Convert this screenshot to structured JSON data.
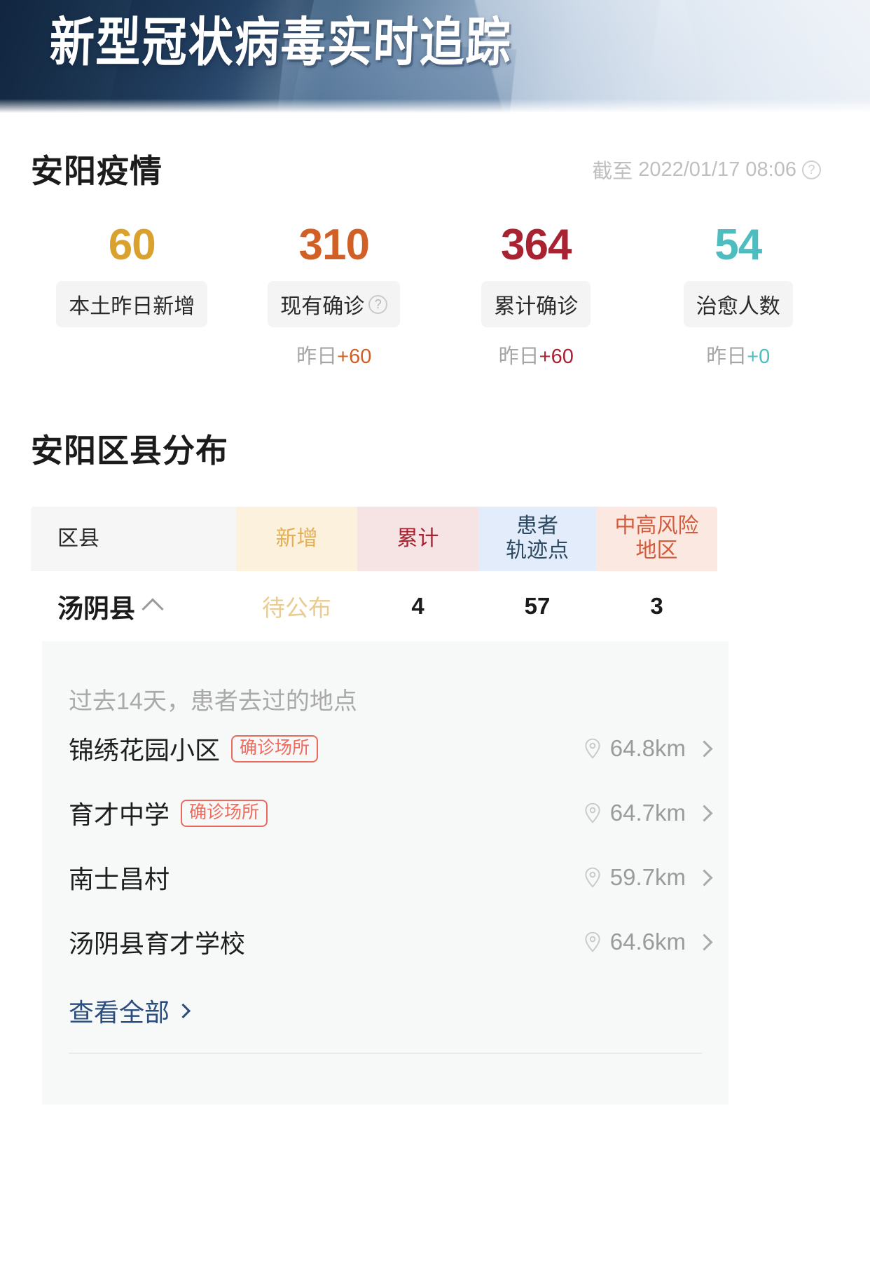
{
  "hero": {
    "title": "新型冠状病毒实时追踪"
  },
  "overview": {
    "title": "安阳疫情",
    "asof_prefix": "截至",
    "asof_time": "2022/01/17 08:06",
    "help_icon": "question-circle-icon",
    "stats": [
      {
        "value": "60",
        "label": "本土昨日新增",
        "color": "#d9a22e",
        "delta_prefix": "",
        "delta": "",
        "has_help": false
      },
      {
        "value": "310",
        "label": "现有确诊",
        "color": "#d06026",
        "delta_prefix": "昨日",
        "delta": "+60",
        "has_help": true
      },
      {
        "value": "364",
        "label": "累计确诊",
        "color": "#a82232",
        "delta_prefix": "昨日",
        "delta": "+60",
        "has_help": false
      },
      {
        "value": "54",
        "label": "治愈人数",
        "color": "#4ebdc0",
        "delta_prefix": "昨日",
        "delta": "+0",
        "has_help": false
      }
    ]
  },
  "distribution": {
    "title": "安阳区县分布",
    "columns": [
      {
        "label": "区县",
        "bg": "#f6f6f6",
        "color": "#2a2a2a"
      },
      {
        "label": "新增",
        "bg": "#fcf1dd",
        "color": "#e2b057"
      },
      {
        "label": "累计",
        "bg": "#f6e4e4",
        "color": "#a82232"
      },
      {
        "label": "患者\n轨迹点",
        "bg": "#e2ecfb",
        "color": "#2d4a63"
      },
      {
        "label": "中高风险\n地区",
        "bg": "#fbe8e1",
        "color": "#d35c3e"
      }
    ],
    "rows": [
      {
        "district": "汤阴县",
        "expanded": true,
        "toggle_icon": "chevron-up-icon",
        "new_cases": "待公布",
        "total_cases": "4",
        "track_points": "57",
        "risk_areas": "3"
      }
    ],
    "panel": {
      "title": "过去14天，患者去过的地点",
      "locations": [
        {
          "name": "锦绣花园小区",
          "badge": "确诊场所",
          "distance": "64.8km",
          "pin_icon": "map-pin-icon",
          "chevron_icon": "chevron-right-icon"
        },
        {
          "name": "育才中学",
          "badge": "确诊场所",
          "distance": "64.7km",
          "pin_icon": "map-pin-icon",
          "chevron_icon": "chevron-right-icon"
        },
        {
          "name": "南士昌村",
          "badge": "",
          "distance": "59.7km",
          "pin_icon": "map-pin-icon",
          "chevron_icon": "chevron-right-icon"
        },
        {
          "name": "汤阴县育才学校",
          "badge": "",
          "distance": "64.6km",
          "pin_icon": "map-pin-icon",
          "chevron_icon": "chevron-right-icon"
        }
      ],
      "view_all": "查看全部",
      "view_all_icon": "chevron-right-icon"
    }
  },
  "chart_data": {
    "type": "table",
    "title": "安阳区县分布",
    "columns": [
      "区县",
      "新增",
      "累计",
      "患者轨迹点",
      "中高风险地区"
    ],
    "rows": [
      [
        "汤阴县",
        "待公布",
        4,
        57,
        3
      ]
    ]
  }
}
